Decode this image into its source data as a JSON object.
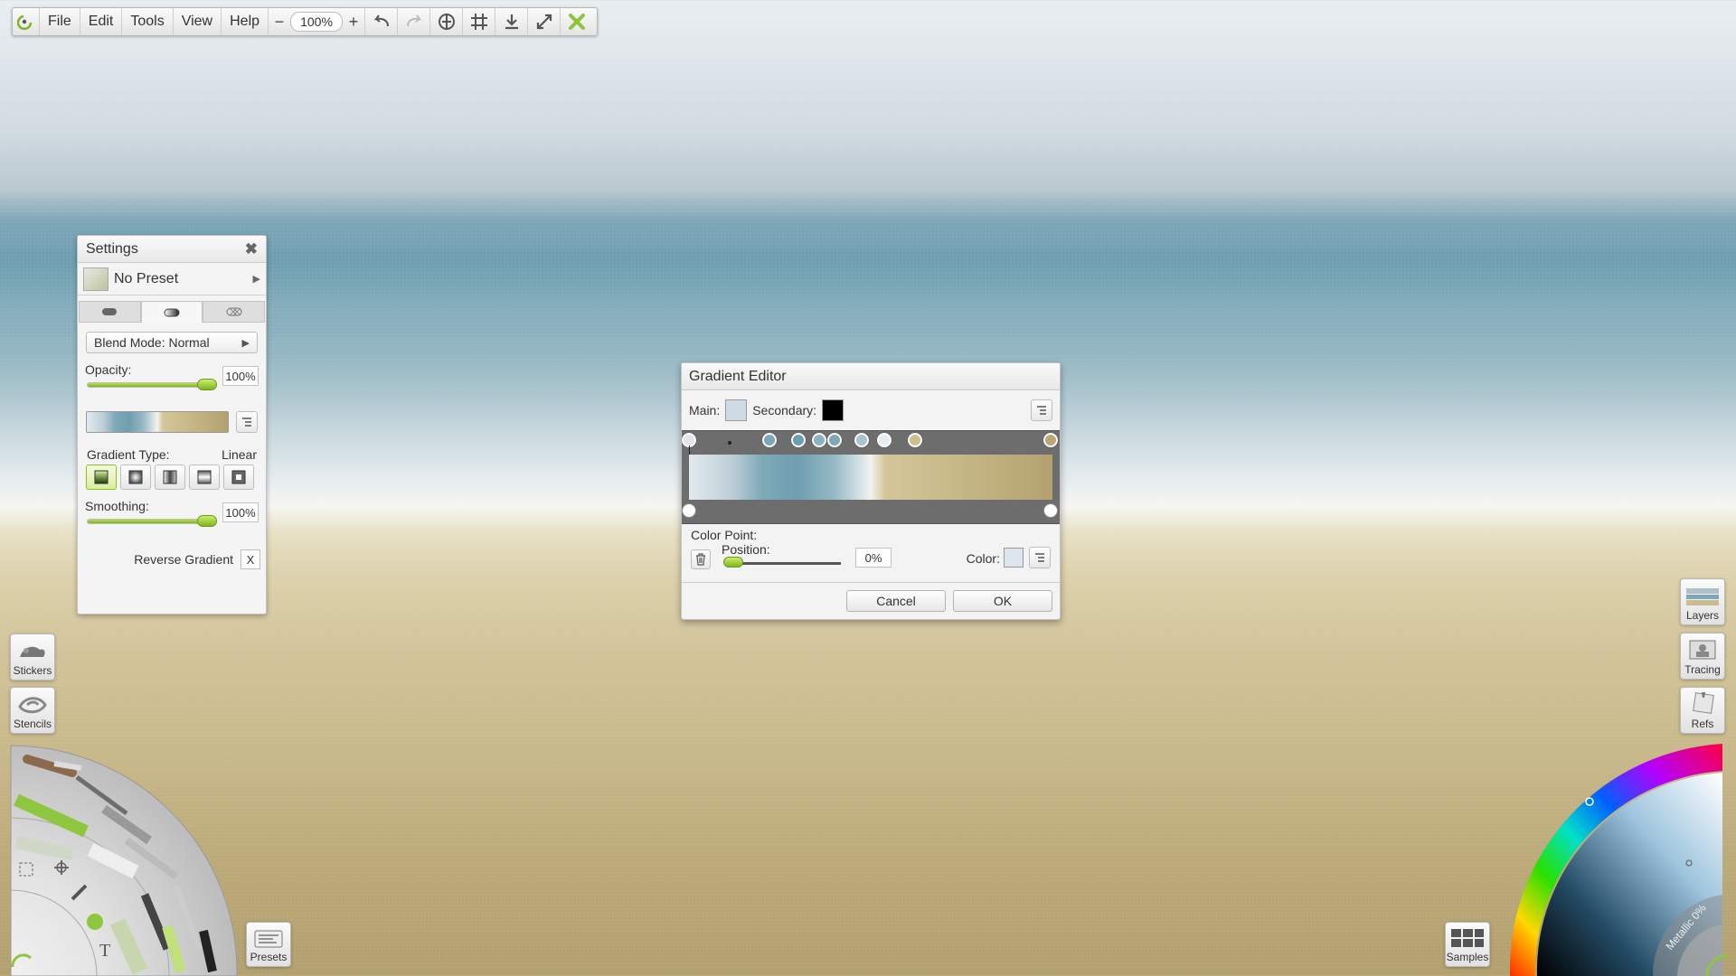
{
  "menubar": {
    "items": [
      "File",
      "Edit",
      "Tools",
      "View",
      "Help"
    ],
    "zoom_minus": "−",
    "zoom_value": "100%",
    "zoom_plus": "+",
    "icons": [
      "undo-icon",
      "redo-icon",
      "symmetry-icon",
      "grid-icon",
      "export-icon",
      "fullscreen-icon",
      "close-app-icon"
    ]
  },
  "settings": {
    "title": "Settings",
    "close": "✖",
    "preset": "No Preset",
    "blend_mode": "Blend Mode: Normal",
    "opacity_label": "Opacity:",
    "opacity_value": "100%",
    "opacity_level": 1.0,
    "gradient_type_label": "Gradient Type:",
    "gradient_type_value": "Linear",
    "smoothing_label": "Smoothing:",
    "smoothing_value": "100%",
    "smoothing_level": 1.0,
    "reverse_label": "Reverse Gradient",
    "reverse_button": "X"
  },
  "gradient_editor": {
    "title": "Gradient Editor",
    "main_label": "Main:",
    "main_color": "#cfdbe4",
    "secondary_label": "Secondary:",
    "secondary_color": "#000000",
    "color_point_label": "Color Point:",
    "position_label": "Position:",
    "position_value": "0%",
    "color_label": "Color:",
    "cancel": "Cancel",
    "ok": "OK"
  },
  "side_left": {
    "stickers": "Stickers",
    "stencils": "Stencils"
  },
  "side_right": {
    "layers": "Layers",
    "tracing": "Tracing",
    "refs": "Refs"
  },
  "bottom": {
    "presets": "Presets",
    "samples": "Samples"
  },
  "color_wheel": {
    "metallic": "Metallic 0%"
  },
  "colors": {
    "accent": "#8dc43a",
    "panel": "#f4f4f4"
  }
}
